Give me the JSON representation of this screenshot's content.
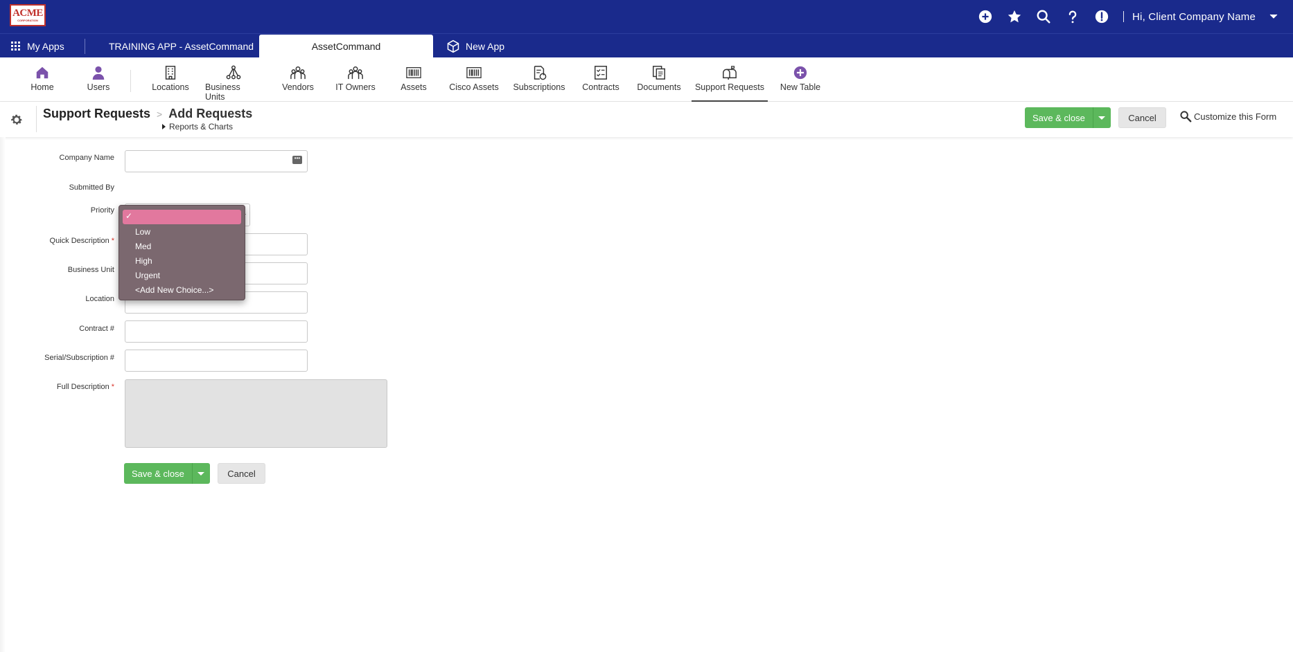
{
  "brand": {
    "logo_line1": "ACME",
    "logo_line2": "CORPORATION"
  },
  "topbar": {
    "icons": [
      "add-icon",
      "star-icon",
      "search-icon",
      "help-icon",
      "alert-icon"
    ],
    "greeting": "Hi, Client Company Name"
  },
  "apptabs": {
    "my_apps": "My Apps",
    "training": "TRAINING APP - AssetCommand",
    "active": "AssetCommand",
    "new_app": "New App"
  },
  "tables": [
    {
      "label": "Home",
      "icon": "home-icon"
    },
    {
      "label": "Users",
      "icon": "user-icon"
    },
    {
      "label": "Locations",
      "icon": "building-icon"
    },
    {
      "label": "Business Units",
      "icon": "org-chart-icon"
    },
    {
      "label": "Vendors",
      "icon": "group-icon"
    },
    {
      "label": "IT Owners",
      "icon": "group-icon"
    },
    {
      "label": "Assets",
      "icon": "barcode-icon"
    },
    {
      "label": "Cisco Assets",
      "icon": "barcode-icon"
    },
    {
      "label": "Subscriptions",
      "icon": "document-money-icon"
    },
    {
      "label": "Contracts",
      "icon": "checklist-icon"
    },
    {
      "label": "Documents",
      "icon": "documents-icon"
    },
    {
      "label": "Support Requests",
      "icon": "mailbox-icon"
    },
    {
      "label": "New Table",
      "icon": "add-circle-icon"
    }
  ],
  "page": {
    "breadcrumb_parent": "Support Requests",
    "breadcrumb_separator": ">",
    "title": "Add Requests",
    "reports_link": "Reports & Charts"
  },
  "actions": {
    "save_close": "Save & close",
    "cancel": "Cancel",
    "customize": "Customize this Form"
  },
  "form": {
    "company_name": {
      "label": "Company Name",
      "value": ""
    },
    "submitted_by": {
      "label": "Submitted By",
      "value": ""
    },
    "priority": {
      "label": "Priority",
      "value": ""
    },
    "quick_description": {
      "label": "Quick Description",
      "required": true,
      "value": ""
    },
    "business_unit": {
      "label": "Business Unit",
      "value": ""
    },
    "location": {
      "label": "Location",
      "value": ""
    },
    "contract": {
      "label": "Contract #",
      "value": ""
    },
    "serial": {
      "label": "Serial/Subscription #",
      "value": ""
    },
    "full_description": {
      "label": "Full Description",
      "required": true,
      "value": ""
    }
  },
  "priority_dropdown": {
    "check": "✓",
    "options": [
      "",
      "Low",
      "Med",
      "High",
      "Urgent",
      "<Add New Choice...>"
    ],
    "selected_index": 0
  },
  "colors": {
    "topbar": "#1a2a8c",
    "save_button": "#5cb85c",
    "nav_icon_accent": "#7b52ab",
    "dropdown_bg": "#7b686f",
    "dropdown_selected": "#e2789e",
    "required_star": "#d9342b"
  }
}
